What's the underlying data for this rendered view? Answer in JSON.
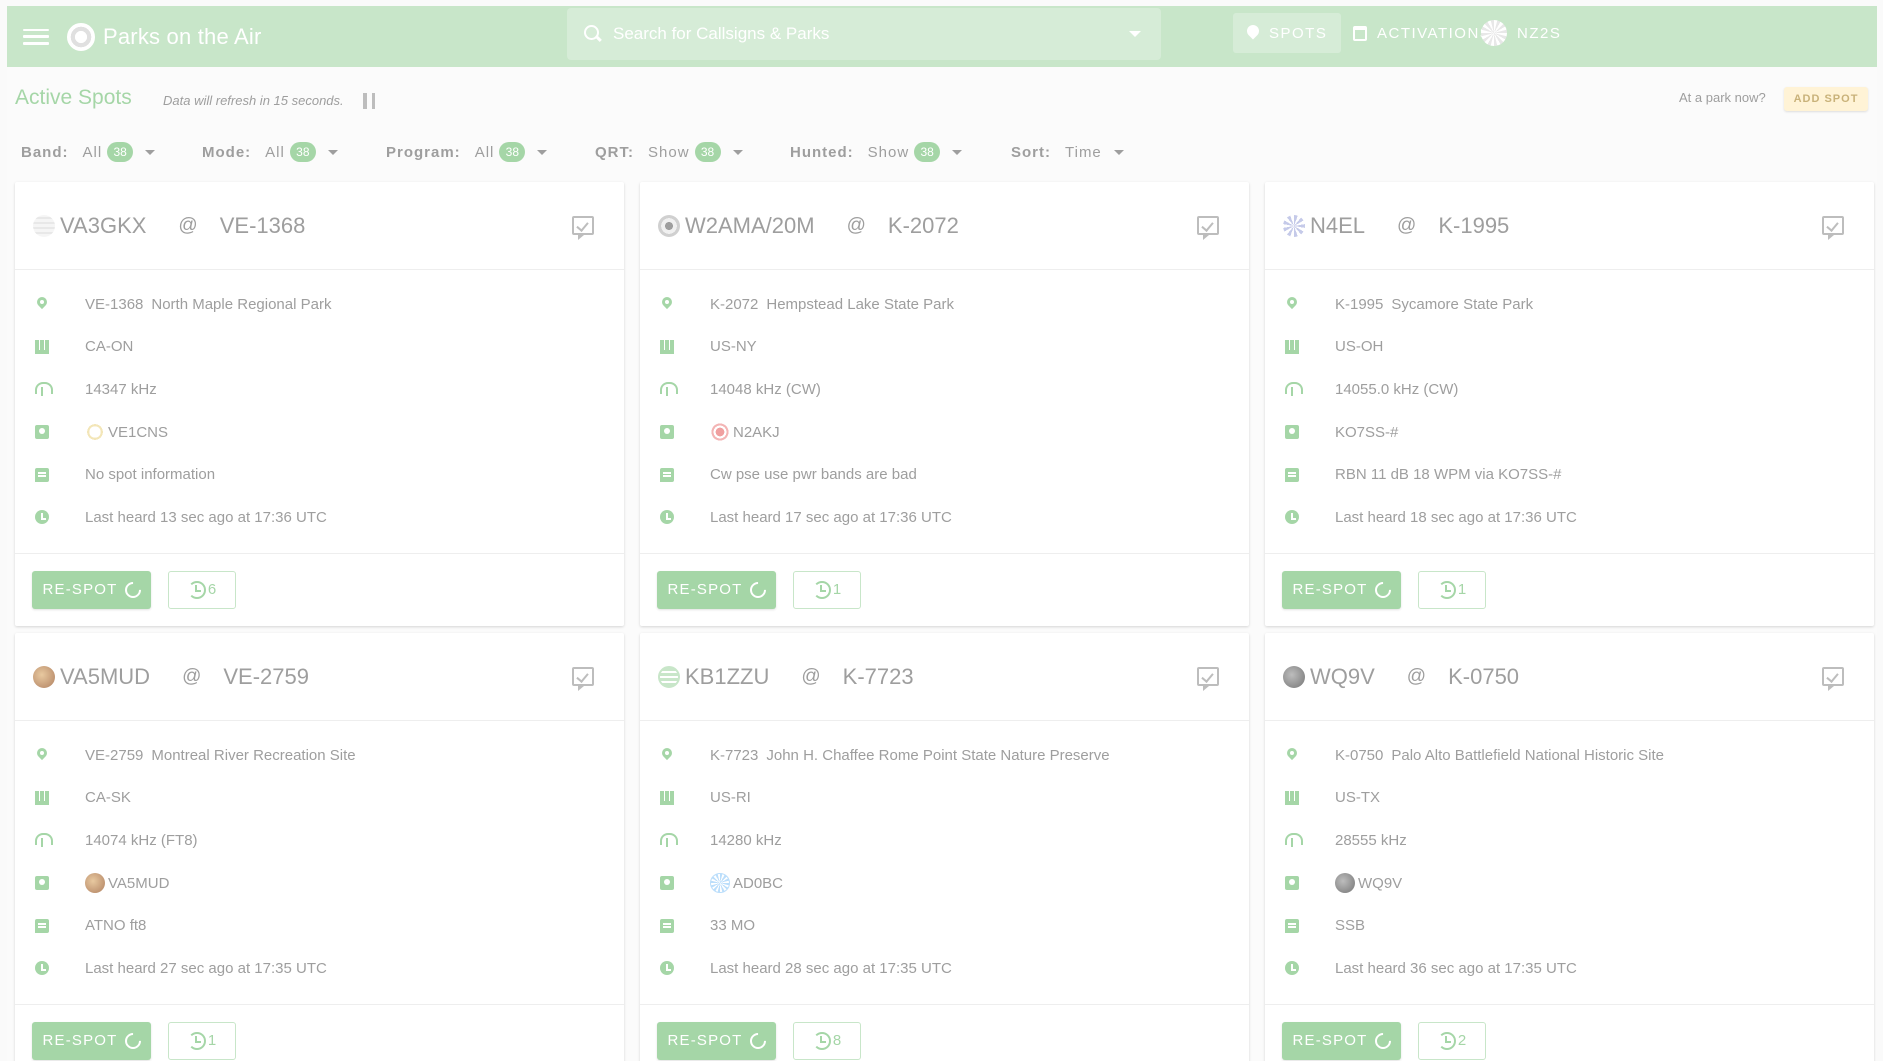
{
  "header": {
    "brand": "Parks on the Air",
    "search_placeholder": "Search for Callsigns & Parks",
    "nav": {
      "spots": "SPOTS",
      "activations": "ACTIVATIONS",
      "user": "NZ2S"
    }
  },
  "subheader": {
    "title": "Active Spots",
    "refresh_note": "Data will refresh in 15 seconds.",
    "at_park": "At a park now?",
    "add_spot": "ADD SPOT"
  },
  "filters": [
    {
      "label": "Band:",
      "value": "All",
      "count": "38"
    },
    {
      "label": "Mode:",
      "value": "All",
      "count": "38"
    },
    {
      "label": "Program:",
      "value": "All",
      "count": "38"
    },
    {
      "label": "QRT:",
      "value": "Show",
      "count": "38"
    },
    {
      "label": "Hunted:",
      "value": "Show",
      "count": "38"
    },
    {
      "label": "Sort:",
      "value": "Time",
      "count": ""
    }
  ],
  "colors": {
    "accent": "#a5d6a7",
    "appbar": "#c8e6c9",
    "add_spot_bg": "#fff3d6"
  },
  "cards": [
    {
      "callsign": "VA3GKX",
      "at": "@",
      "park": "VE-1368",
      "park_ref": "VE-1368",
      "park_name": "North Maple Regional Park",
      "location": "CA-ON",
      "frequency": "14347 kHz",
      "spotter": "VE1CNS",
      "comment": "No spot information",
      "heard": "Last heard 13 sec ago at 17:36 UTC",
      "respot": "RE-SPOT",
      "history_count": "6"
    },
    {
      "callsign": "W2AMA/20M",
      "at": "@",
      "park": "K-2072",
      "park_ref": "K-2072",
      "park_name": "Hempstead Lake State Park",
      "location": "US-NY",
      "frequency": "14048 kHz (CW)",
      "spotter": "N2AKJ",
      "comment": "Cw pse use pwr bands are bad",
      "heard": "Last heard 17 sec ago at 17:36 UTC",
      "respot": "RE-SPOT",
      "history_count": "1"
    },
    {
      "callsign": "N4EL",
      "at": "@",
      "park": "K-1995",
      "park_ref": "K-1995",
      "park_name": "Sycamore State Park",
      "location": "US-OH",
      "frequency": "14055.0 kHz (CW)",
      "spotter": "KO7SS-#",
      "comment": "RBN 11 dB 18 WPM via KO7SS-#",
      "heard": "Last heard 18 sec ago at 17:36 UTC",
      "respot": "RE-SPOT",
      "history_count": "1"
    },
    {
      "callsign": "VA5MUD",
      "at": "@",
      "park": "VE-2759",
      "park_ref": "VE-2759",
      "park_name": "Montreal River Recreation Site",
      "location": "CA-SK",
      "frequency": "14074 kHz (FT8)",
      "spotter": "VA5MUD",
      "comment": "ATNO ft8",
      "heard": "Last heard 27 sec ago at 17:35 UTC",
      "respot": "RE-SPOT",
      "history_count": "1"
    },
    {
      "callsign": "KB1ZZU",
      "at": "@",
      "park": "K-7723",
      "park_ref": "K-7723",
      "park_name": "John H. Chaffee Rome Point State Nature Preserve",
      "location": "US-RI",
      "frequency": "14280 kHz",
      "spotter": "AD0BC",
      "comment": "33 MO",
      "heard": "Last heard 28 sec ago at 17:35 UTC",
      "respot": "RE-SPOT",
      "history_count": "8"
    },
    {
      "callsign": "WQ9V",
      "at": "@",
      "park": "K-0750",
      "park_ref": "K-0750",
      "park_name": "Palo Alto Battlefield National Historic Site",
      "location": "US-TX",
      "frequency": "28555 kHz",
      "spotter": "WQ9V",
      "comment": "SSB",
      "heard": "Last heard 36 sec ago at 17:35 UTC",
      "respot": "RE-SPOT",
      "history_count": "2"
    }
  ]
}
